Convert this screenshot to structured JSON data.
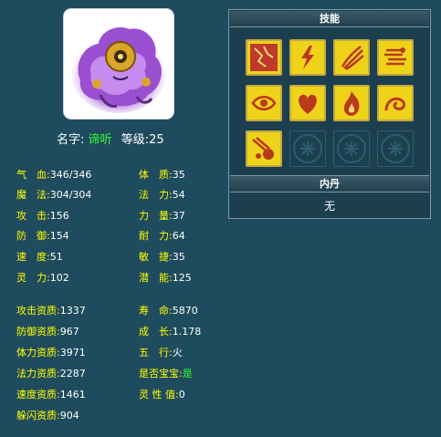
{
  "pet": {
    "name_label": "名字:",
    "name": "谛听",
    "level_label": "等级:",
    "level": "25"
  },
  "stats_left": [
    {
      "label": "气　血:",
      "value": "346/346"
    },
    {
      "label": "魔　法:",
      "value": "304/304"
    },
    {
      "label": "攻　击:",
      "value": "156"
    },
    {
      "label": "防　御:",
      "value": "154"
    },
    {
      "label": "速　度:",
      "value": "51"
    },
    {
      "label": "灵　力:",
      "value": "102"
    }
  ],
  "stats_right": [
    {
      "label": "体　质:",
      "value": "35"
    },
    {
      "label": "法　力:",
      "value": "54"
    },
    {
      "label": "力　量:",
      "value": "37"
    },
    {
      "label": "耐　力:",
      "value": "64"
    },
    {
      "label": "敏　捷:",
      "value": "35"
    },
    {
      "label": "潜　能:",
      "value": "125"
    }
  ],
  "aptitudes_left": [
    {
      "label": "攻击资质:",
      "value": "1337"
    },
    {
      "label": "防御资质:",
      "value": "967"
    },
    {
      "label": "体力资质:",
      "value": "3971"
    },
    {
      "label": "法力资质:",
      "value": "2287"
    },
    {
      "label": "速度资质:",
      "value": "1461"
    },
    {
      "label": "躲闪资质:",
      "value": "904"
    }
  ],
  "aptitudes_right": [
    {
      "label": "寿　命:",
      "value": "5870"
    },
    {
      "label": "成　长:",
      "value": "1.178"
    },
    {
      "label": "五　行:",
      "value": "火"
    },
    {
      "label": "是否宝宝:",
      "value": "是"
    },
    {
      "label": "灵 性 值:",
      "value": "0"
    }
  ],
  "skills_panel": {
    "title": "技能",
    "skills": [
      {
        "icon": "cracked-earth-icon"
      },
      {
        "icon": "lightning-icon"
      },
      {
        "icon": "triple-claw-icon"
      },
      {
        "icon": "speed-lines-icon"
      },
      {
        "icon": "eye-icon"
      },
      {
        "icon": "heart-icon"
      },
      {
        "icon": "flame-icon"
      },
      {
        "icon": "swirl-icon"
      },
      {
        "icon": "meteor-icon"
      }
    ],
    "empty_slots": 3
  },
  "neidan": {
    "title": "内丹",
    "value": "无"
  },
  "colors": {
    "background": "#1f4b5e",
    "label": "#ffff00",
    "value": "#ffffff",
    "highlight": "#33ff33",
    "skill_bg": "#e8d51a"
  }
}
